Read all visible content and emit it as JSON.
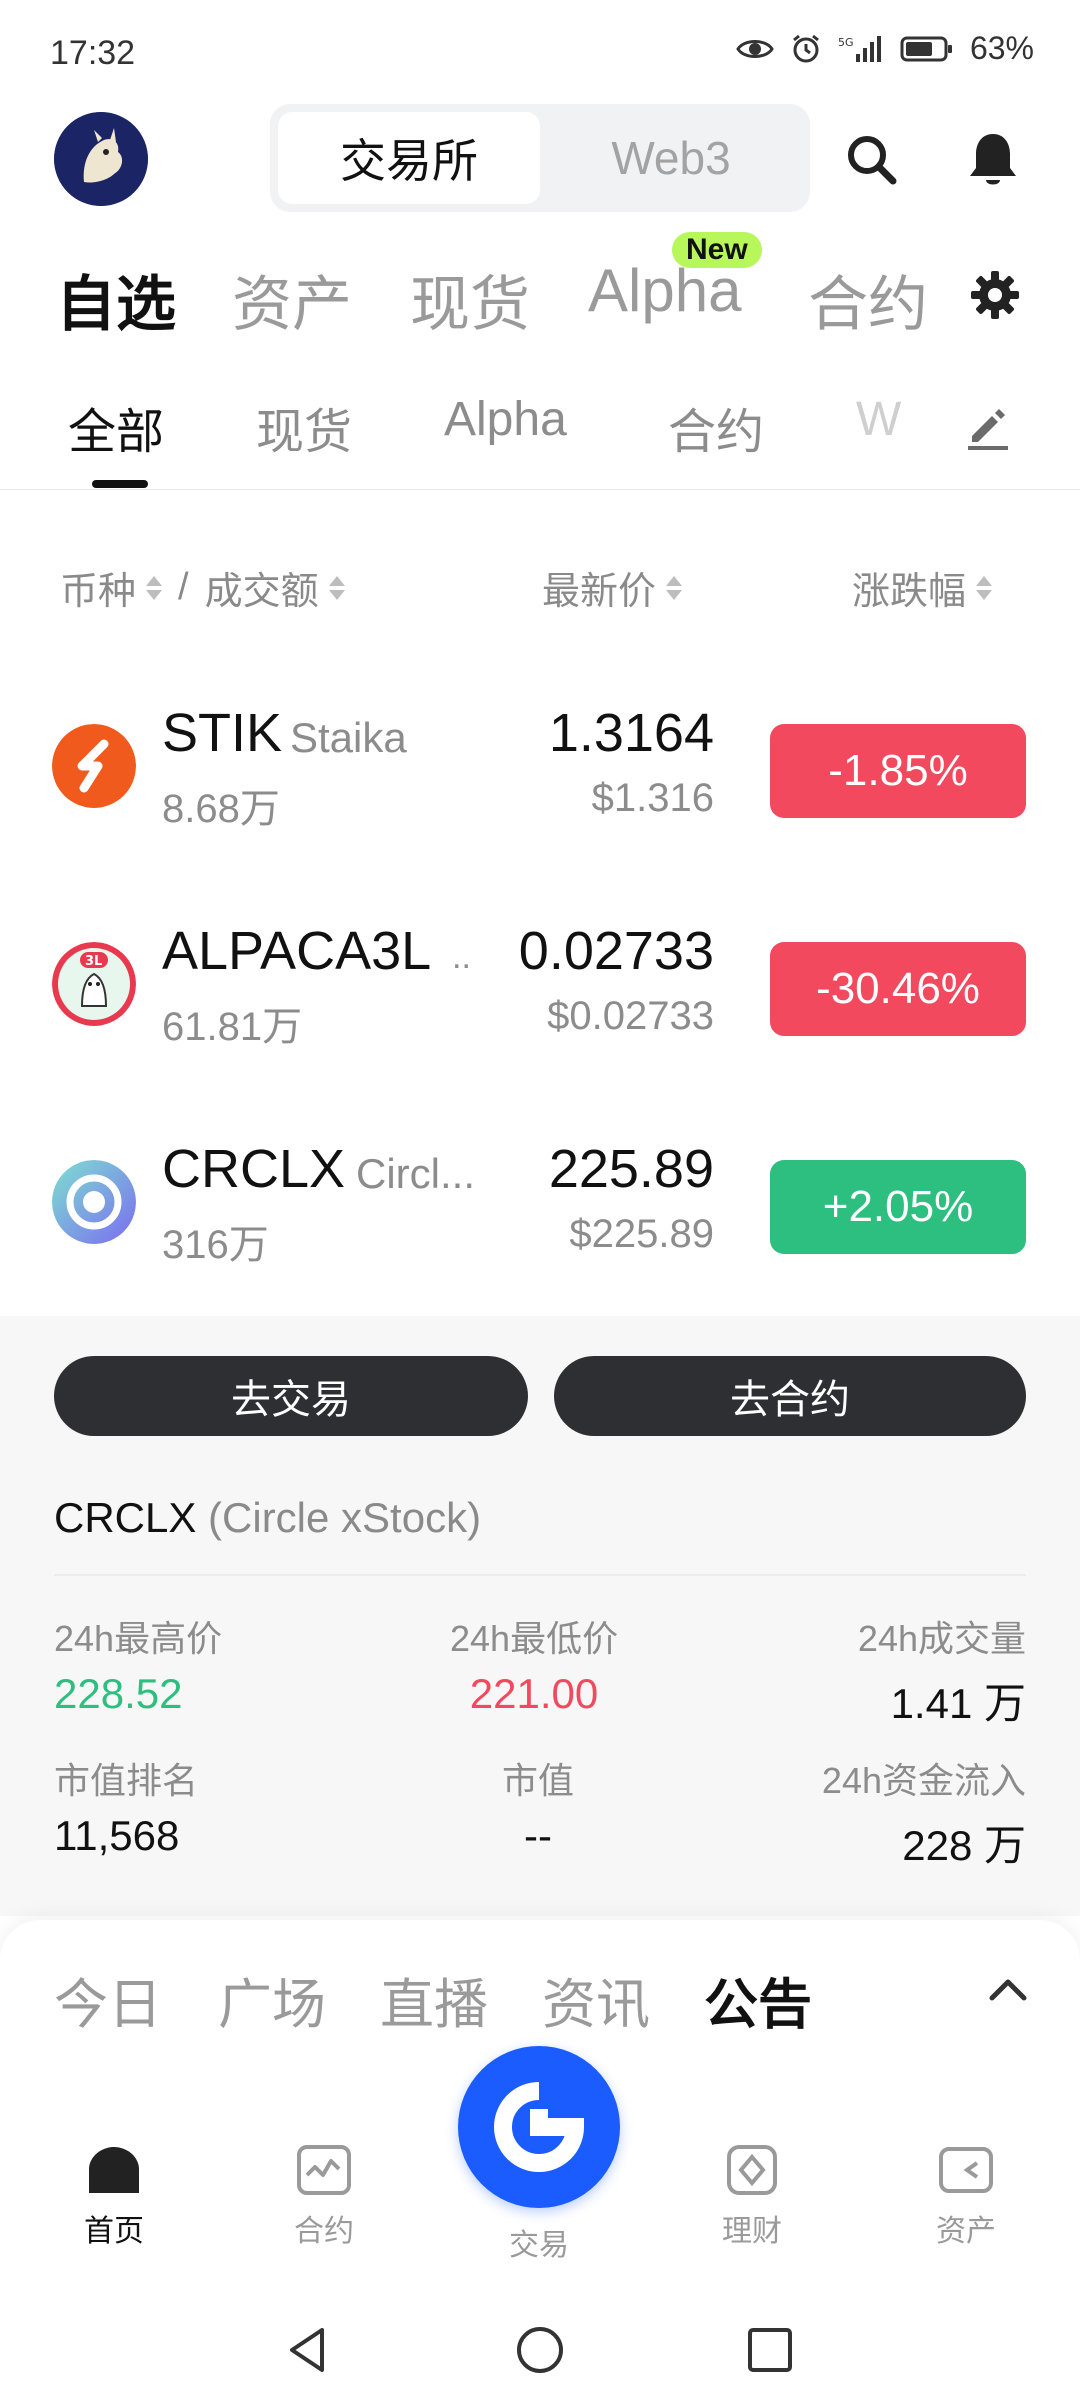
{
  "status_bar": {
    "time": "17:32",
    "network": "5G",
    "battery": "63%"
  },
  "header": {
    "segments": [
      "交易所",
      "Web3"
    ],
    "active_segment": 0
  },
  "main_tabs": {
    "items": [
      "自选",
      "资产",
      "现货",
      "Alpha",
      "合约"
    ],
    "active": 0,
    "new_badge": "New"
  },
  "sub_tabs": {
    "items": [
      "全部",
      "现货",
      "Alpha",
      "合约",
      "W"
    ],
    "active": 0
  },
  "list_header": {
    "symbol": "币种",
    "sep": "/",
    "volume": "成交额",
    "price": "最新价",
    "change": "涨跌幅"
  },
  "coins": [
    {
      "symbol": "STIK",
      "name": "Staika",
      "volume": "8.68万",
      "price": "1.3164",
      "usd": "$1.316",
      "change": "-1.85%",
      "direction": "down",
      "logo_color": "#f05a1c"
    },
    {
      "symbol": "ALPACA3L",
      "name": "..",
      "volume": "61.81万",
      "price": "0.02733",
      "usd": "$0.02733",
      "change": "-30.46%",
      "direction": "down",
      "logo_color": "#e8394f"
    },
    {
      "symbol": "CRCLX",
      "name": "Circl...",
      "volume": "316万",
      "price": "225.89",
      "usd": "$225.89",
      "change": "+2.05%",
      "direction": "up",
      "logo_color": "#3b82f6"
    }
  ],
  "detail": {
    "go_trade": "去交易",
    "go_futures": "去合约",
    "title_symbol": "CRCLX",
    "title_name": "(Circle xStock)",
    "stats": {
      "high_label": "24h最高价",
      "high_value": "228.52",
      "low_label": "24h最低价",
      "low_value": "221.00",
      "volume_label": "24h成交量",
      "volume_value": "1.41 万",
      "rank_label": "市值排名",
      "rank_value": "11,568",
      "mcap_label": "市值",
      "mcap_value": "--",
      "inflow_label": "24h资金流入",
      "inflow_value": "228 万"
    }
  },
  "feed_tabs": {
    "items": [
      "今日",
      "广场",
      "直播",
      "资讯",
      "公告"
    ],
    "active": 4
  },
  "bottom_nav": {
    "home": "首页",
    "futures": "合约",
    "trade": "交易",
    "earn": "理财",
    "assets": "资产"
  },
  "colors": {
    "up": "#2dbf7f",
    "down": "#f2495e",
    "brand": "#1a5cff",
    "new_badge": "#b7f75a"
  }
}
